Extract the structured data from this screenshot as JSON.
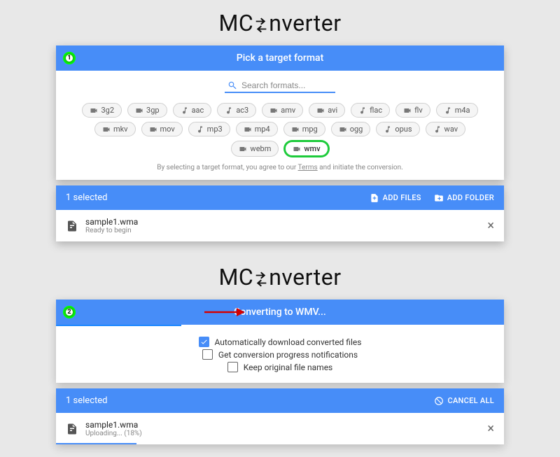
{
  "brand": {
    "pre": "MC",
    "post": "nverter"
  },
  "step1": {
    "title": "Pick a target format",
    "search_placeholder": "Search formats...",
    "formats": [
      {
        "label": "3g2",
        "icon": "video"
      },
      {
        "label": "3gp",
        "icon": "video"
      },
      {
        "label": "aac",
        "icon": "audio"
      },
      {
        "label": "ac3",
        "icon": "audio"
      },
      {
        "label": "amv",
        "icon": "video"
      },
      {
        "label": "avi",
        "icon": "video"
      },
      {
        "label": "flac",
        "icon": "audio"
      },
      {
        "label": "flv",
        "icon": "video"
      },
      {
        "label": "m4a",
        "icon": "audio"
      },
      {
        "label": "mkv",
        "icon": "video"
      },
      {
        "label": "mov",
        "icon": "video"
      },
      {
        "label": "mp3",
        "icon": "audio"
      },
      {
        "label": "mp4",
        "icon": "video"
      },
      {
        "label": "mpg",
        "icon": "video"
      },
      {
        "label": "ogg",
        "icon": "video"
      },
      {
        "label": "opus",
        "icon": "audio"
      },
      {
        "label": "wav",
        "icon": "audio"
      },
      {
        "label": "webm",
        "icon": "video"
      },
      {
        "label": "wmv",
        "icon": "video",
        "selected": true
      }
    ],
    "disclaimer_pre": "By selecting a target format, you agree to our ",
    "disclaimer_link": "Terms",
    "disclaimer_post": " and initiate the conversion."
  },
  "files1": {
    "count_label": "1 selected",
    "add_files": "ADD FILES",
    "add_folder": "ADD FOLDER",
    "file": {
      "name": "sample1.wma",
      "status": "Ready to begin"
    }
  },
  "step2": {
    "title": "Converting to WMV...",
    "progress_percent": 28,
    "options": [
      {
        "label": "Automatically download converted files",
        "checked": true
      },
      {
        "label": "Get conversion progress notifications",
        "checked": false
      },
      {
        "label": "Keep original file names",
        "checked": false
      }
    ]
  },
  "files2": {
    "count_label": "1 selected",
    "cancel_all": "CANCEL ALL",
    "file": {
      "name": "sample1.wma",
      "status": "Uploading... (18%)",
      "progress": 18
    }
  }
}
